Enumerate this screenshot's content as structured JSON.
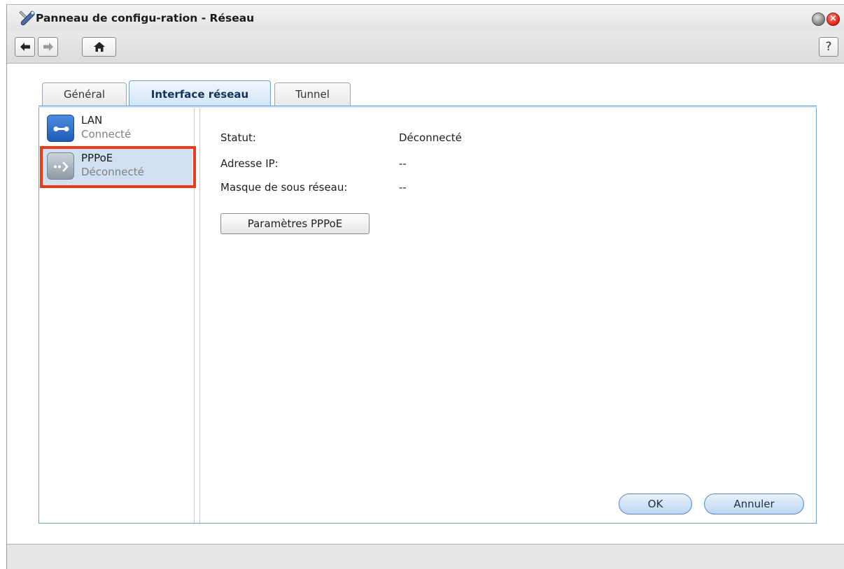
{
  "window": {
    "title": "Panneau de configu-ration - Réseau",
    "app_icon": "wrench-screwdriver-icon",
    "minimize_icon": "minimize-icon",
    "close_icon": "close-icon"
  },
  "toolbar": {
    "back_icon": "arrow-left-icon",
    "forward_icon": "arrow-right-icon",
    "home_icon": "home-icon",
    "help_label": "?"
  },
  "tabs": [
    {
      "label": "Général",
      "active": false
    },
    {
      "label": "Interface réseau",
      "active": true
    },
    {
      "label": "Tunnel",
      "active": false
    }
  ],
  "interfaces": [
    {
      "name": "LAN",
      "status": "Connecté",
      "icon": "lan-icon",
      "selected": false
    },
    {
      "name": "PPPoE",
      "status": "Déconnecté",
      "icon": "pppoe-icon",
      "selected": true
    }
  ],
  "details": {
    "status_label": "Statut:",
    "status_value": "Déconnecté",
    "ip_label": "Adresse IP:",
    "ip_value": "--",
    "mask_label": "Masque de sous réseau:",
    "mask_value": "--",
    "settings_button": "Paramètres PPPoE"
  },
  "footer": {
    "ok_label": "OK",
    "cancel_label": "Annuler"
  },
  "colors": {
    "active_tab": "#cfe3f7",
    "selection": "#cfe0f3",
    "highlight_border": "#ef3a1a",
    "close_button": "#e0261a",
    "lan_icon": "#1e5cb7"
  }
}
